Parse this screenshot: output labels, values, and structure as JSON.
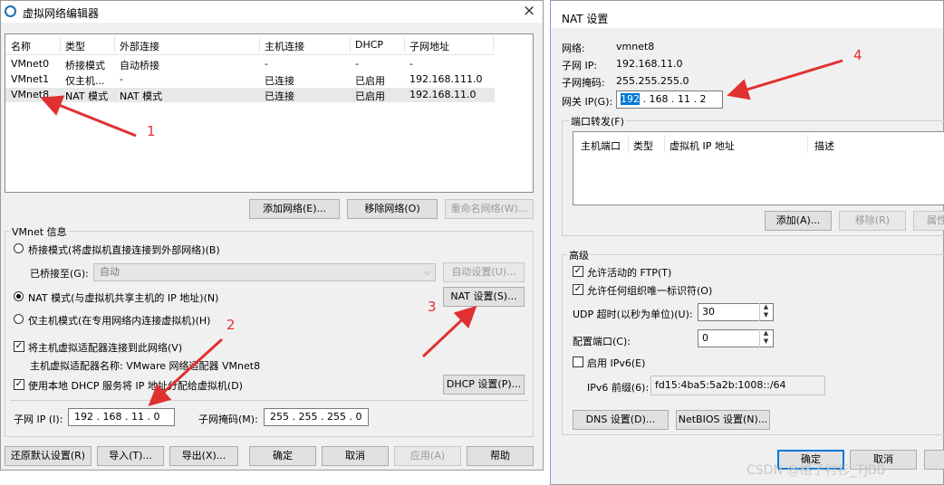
{
  "left": {
    "title": "虚拟网络编辑器",
    "close": "×",
    "columns": [
      "名称",
      "类型",
      "外部连接",
      "主机连接",
      "DHCP",
      "子网地址"
    ],
    "rows": [
      [
        "VMnet0",
        "桥接模式",
        "自动桥接",
        "-",
        "-",
        "-"
      ],
      [
        "VMnet1",
        "仅主机...",
        "-",
        "已连接",
        "已启用",
        "192.168.111.0"
      ],
      [
        "VMnet8",
        "NAT 模式",
        "NAT 模式",
        "已连接",
        "已启用",
        "192.168.11.0"
      ]
    ],
    "btn_add": "添加网络(E)...",
    "btn_remove": "移除网络(O)",
    "btn_rename": "重命名网络(W)...",
    "info_title": "VMnet 信息",
    "radio_bridge": "桥接模式(将虚拟机直接连接到外部网络)(B)",
    "bridged_to_label": "已桥接至(G):",
    "bridged_to_value": "自动",
    "btn_auto": "自动设置(U)...",
    "radio_nat": "NAT 模式(与虚拟机共享主机的 IP 地址)(N)",
    "btn_nat": "NAT 设置(S)...",
    "radio_host": "仅主机模式(在专用网络内连接虚拟机)(H)",
    "chk_connect": "将主机虚拟适配器连接到此网络(V)",
    "adapter_name": "主机虚拟适配器名称: VMware 网络适配器 VMnet8",
    "chk_dhcp": "使用本地 DHCP 服务将 IP 地址分配给虚拟机(D)",
    "btn_dhcp": "DHCP 设置(P)...",
    "subnet_ip_label": "子网 IP (I):",
    "subnet_ip": "192 . 168 . 11 . 0",
    "mask_label": "子网掩码(M):",
    "mask": "255 . 255 . 255 . 0",
    "btn_restore": "还原默认设置(R)",
    "btn_import": "导入(T)...",
    "btn_export": "导出(X)...",
    "btn_ok": "确定",
    "btn_cancel": "取消",
    "btn_apply": "应用(A)",
    "btn_help": "帮助"
  },
  "right": {
    "title": "NAT 设置",
    "network_label": "网络:",
    "network": "vmnet8",
    "subnet_ip_label": "子网 IP:",
    "subnet_ip": "192.168.11.0",
    "mask_label": "子网掩码:",
    "mask": "255.255.255.0",
    "gateway_label": "网关 IP(G):",
    "gateway_selected": "192",
    "gateway_rest": " . 168 . 11 . 2",
    "port_fwd_label": "端口转发(F)",
    "pf_columns": [
      "主机端口",
      "类型",
      "虚拟机 IP 地址",
      "描述"
    ],
    "btn_add": "添加(A)...",
    "btn_remove": "移除(R)",
    "btn_props": "属性",
    "advanced": "高级",
    "chk_ftp": "允许活动的 FTP(T)",
    "chk_oui": "允许任何组织唯一标识符(O)",
    "udp_label": "UDP 超时(以秒为单位)(U):",
    "udp_value": "30",
    "config_port_label": "配置端口(C):",
    "config_port_value": "0",
    "chk_ipv6": "启用 IPv6(E)",
    "ipv6_prefix_label": "IPv6 前缀(6):",
    "ipv6_prefix": "fd15:4ba5:5a2b:1008::/64",
    "btn_dns": "DNS 设置(D)...",
    "btn_netbios": "NetBIOS 设置(N)...",
    "btn_ok": "确定",
    "btn_cancel": "取消"
  },
  "annotations": [
    "1",
    "2",
    "3",
    "4"
  ],
  "watermark": "CSDN @格子衬衫_TJBB",
  "annotation_color": "#e03131"
}
